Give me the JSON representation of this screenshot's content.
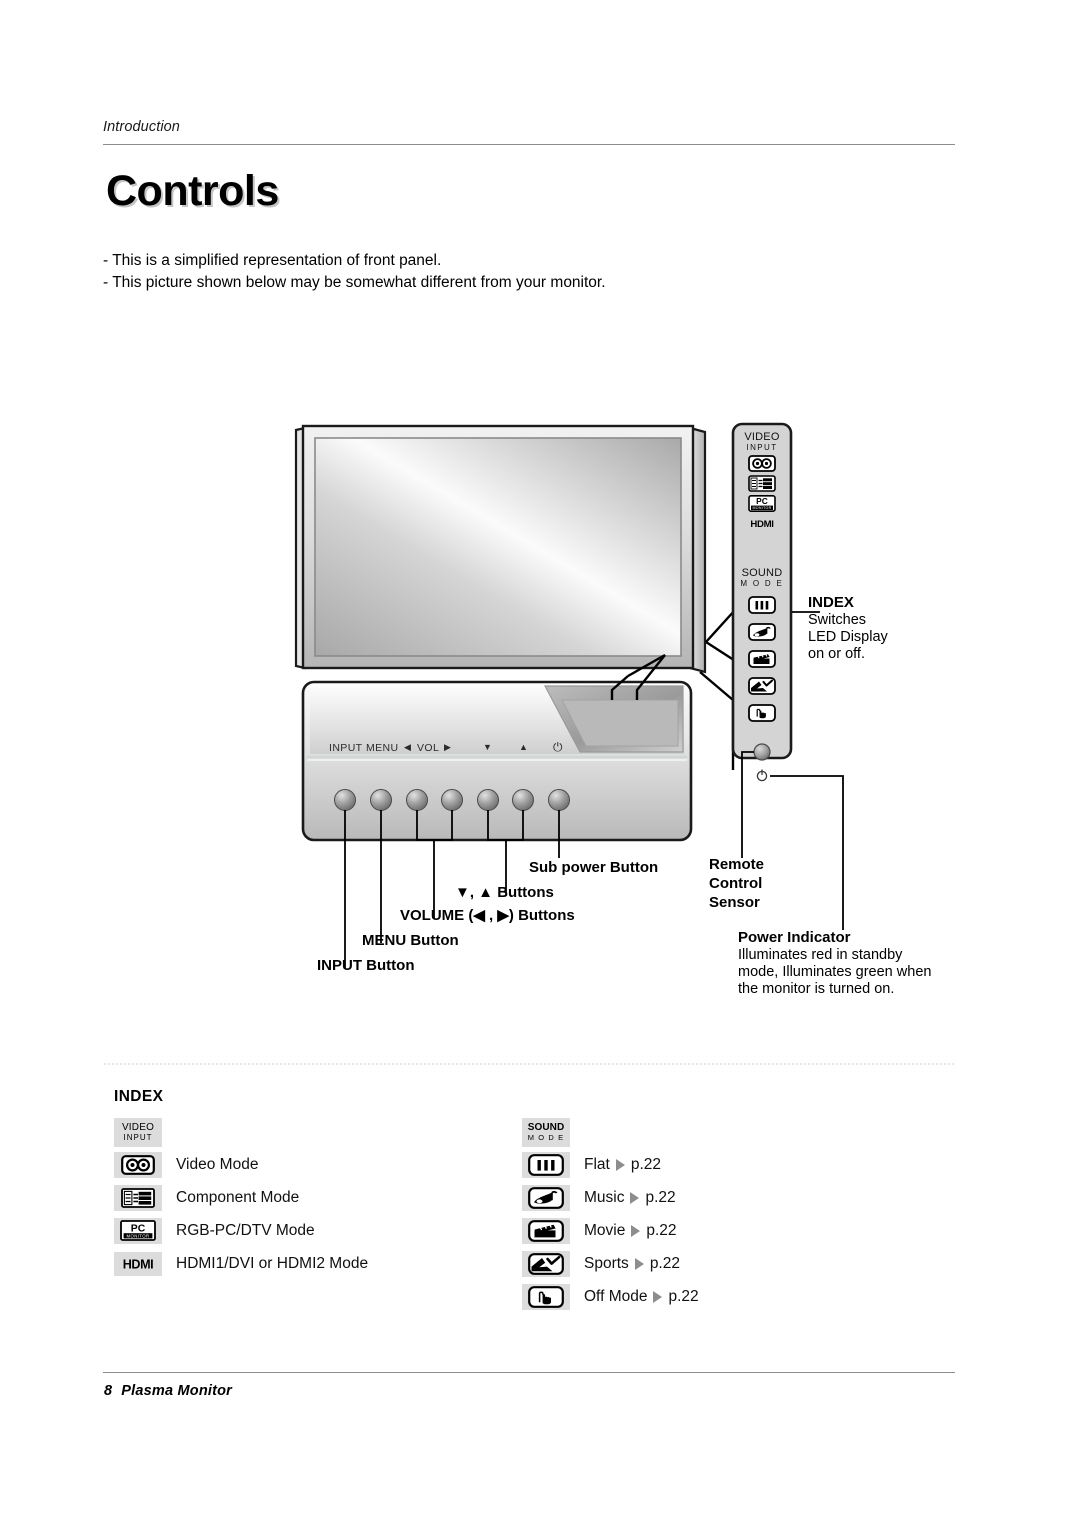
{
  "header": {
    "chapter": "Introduction",
    "title": "Controls"
  },
  "intro": {
    "line1": "- This is a simplified representation of front panel.",
    "line2": "- This picture shown below may be somewhat different from your monitor."
  },
  "front_panel": {
    "osd_labels": {
      "input": "INPUT",
      "menu": "MENU",
      "vol_left": "◀",
      "vol": "VOL",
      "vol_right": "▶",
      "down": "▼",
      "up": "▲",
      "power": "⏻"
    },
    "callouts": {
      "sub_power": "Sub power Button",
      "updown": "▼, ▲ Buttons",
      "volume": "VOLUME (◀ , ▶) Buttons",
      "menu": "MENU Button",
      "input": "INPUT Button"
    }
  },
  "side_panel": {
    "video_input_line1": "VIDEO",
    "video_input_line2": "INPUT",
    "sound_mode_line1": "SOUND",
    "sound_mode_line2": "M O D E",
    "hdmi_text": "HDMI",
    "pc_text": "PC",
    "pc_sub_text": "MONITOR",
    "callouts": {
      "index_title": "INDEX",
      "index_body_1": "Switches",
      "index_body_2": "LED Display",
      "index_body_3": "on or off.",
      "remote_1": "Remote",
      "remote_2": "Control",
      "remote_3": "Sensor",
      "power_indicator_title": "Power Indicator",
      "power_indicator_1": "Illuminates red in standby",
      "power_indicator_2": "mode, Illuminates green when",
      "power_indicator_3": "the monitor is turned on."
    }
  },
  "index_legend": {
    "heading": "INDEX",
    "left_column": {
      "header_icon": "video-input-chip",
      "header_line1": "VIDEO",
      "header_line2": "INPUT",
      "rows": [
        {
          "icon": "video-mode-icon",
          "label": "Video Mode"
        },
        {
          "icon": "component-mode-icon",
          "label": "Component Mode"
        },
        {
          "icon": "rgb-pc-dtv-icon",
          "label": "RGB-PC/DTV Mode"
        },
        {
          "icon": "hdmi-icon",
          "label": "HDMI1/DVI or HDMI2 Mode"
        }
      ]
    },
    "right_column": {
      "header_icon": "sound-mode-chip",
      "header_line1": "SOUND",
      "header_line2": "M O D E",
      "rows": [
        {
          "icon": "flat-sound-icon",
          "label": "Flat",
          "page": "p.22"
        },
        {
          "icon": "music-sound-icon",
          "label": "Music",
          "page": "p.22"
        },
        {
          "icon": "movie-sound-icon",
          "label": "Movie",
          "page": "p.22"
        },
        {
          "icon": "sports-sound-icon",
          "label": "Sports",
          "page": "p.22"
        },
        {
          "icon": "off-mode-icon",
          "label": "Off Mode",
          "page": "p.22"
        }
      ]
    }
  },
  "footer": {
    "page_number": "8",
    "document_name": "Plasma Monitor"
  },
  "colors": {
    "rule": "#8c8c8c",
    "chip_background": "#dcdcdc",
    "ink": "#000000",
    "panel_fill": "#d4d4d4"
  }
}
